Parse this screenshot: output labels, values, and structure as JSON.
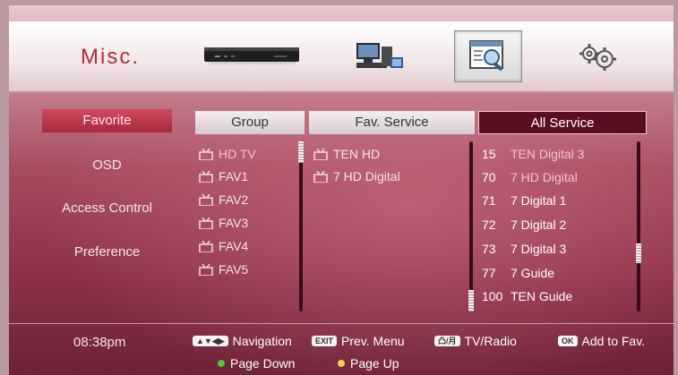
{
  "header": {
    "title": "Misc.",
    "icons": [
      "set-top-box-icon",
      "network-computer-icon",
      "search-window-icon",
      "gears-icon"
    ]
  },
  "sidebar": {
    "items": [
      {
        "label": "Favorite",
        "active": true
      },
      {
        "label": "OSD"
      },
      {
        "label": "Access Control"
      },
      {
        "label": "Preference"
      }
    ]
  },
  "columns": {
    "group": "Group",
    "fav_service": "Fav. Service",
    "all_service": "All Service"
  },
  "groups": [
    "HD TV",
    "FAV1",
    "FAV2",
    "FAV3",
    "FAV4",
    "FAV5"
  ],
  "fav_services": [
    "TEN HD",
    "7 HD Digital"
  ],
  "all_services": [
    {
      "num": "15",
      "name": "TEN Digital 3"
    },
    {
      "num": "70",
      "name": "7 HD Digital"
    },
    {
      "num": "71",
      "name": "7 Digital 1"
    },
    {
      "num": "72",
      "name": "7 Digital 2"
    },
    {
      "num": "73",
      "name": "7 Digital 3"
    },
    {
      "num": "77",
      "name": "7 Guide"
    },
    {
      "num": "100",
      "name": "TEN Guide"
    }
  ],
  "footer": {
    "time": "08:38pm",
    "nav_label": "Navigation",
    "exit_key": "EXIT",
    "prev_label": "Prev. Menu",
    "tvradio_key": "凸/月",
    "tvradio_label": "TV/Radio",
    "ok_key": "OK",
    "ok_label": "Add to Fav.",
    "page_down_label": "Page Down",
    "page_up_label": "Page Up"
  },
  "colors": {
    "accent_red": "#c0263c",
    "selected_header": "#5a0f21",
    "green_dot": "#3fcf3f",
    "yellow_dot": "#e8d84a"
  }
}
